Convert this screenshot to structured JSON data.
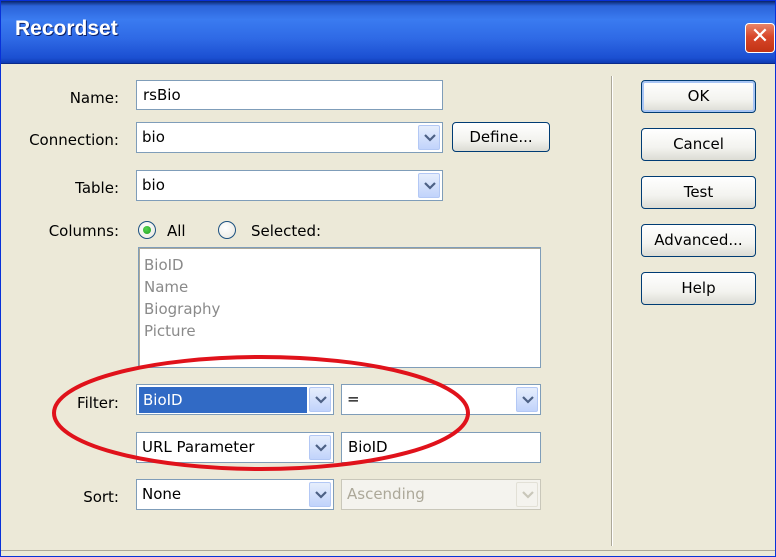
{
  "window": {
    "title": "Recordset",
    "close_glyph": "✕"
  },
  "form": {
    "name": {
      "label": "Name:",
      "value": "rsBio"
    },
    "connection": {
      "label": "Connection:",
      "value": "bio",
      "define_label": "Define..."
    },
    "table": {
      "label": "Table:",
      "value": "bio"
    },
    "columns": {
      "label": "Columns:",
      "all_label": "All",
      "selected_label": "Selected:",
      "selected_option": "All",
      "list": [
        "BioID",
        "Name",
        "Biography",
        "Picture"
      ]
    },
    "filter": {
      "label": "Filter:",
      "column": "BioID",
      "operator": "=",
      "source": "URL Parameter",
      "param": "BioID"
    },
    "sort": {
      "label": "Sort:",
      "column": "None",
      "direction": "Ascending"
    }
  },
  "buttons": {
    "ok": "OK",
    "cancel": "Cancel",
    "test": "Test",
    "advanced": "Advanced...",
    "help": "Help"
  },
  "colors": {
    "titlebar": "#2f6ae6",
    "dialog_bg": "#ece9d8",
    "selection": "#316ac5",
    "annotation": "#e0121b"
  },
  "icons": [
    "close-icon",
    "chevron-down-icon",
    "radio-selected-icon",
    "radio-unselected-icon"
  ]
}
